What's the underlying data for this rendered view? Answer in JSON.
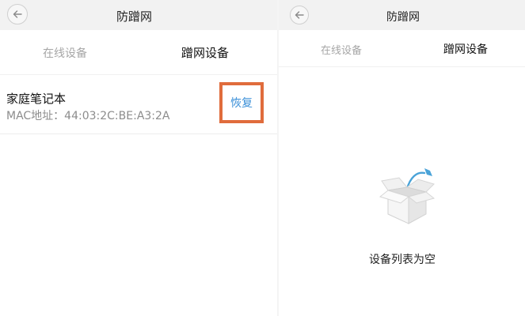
{
  "left_screen": {
    "title": "防蹭网",
    "tabs": [
      {
        "label": "在线设备",
        "active": false
      },
      {
        "label": "蹭网设备",
        "active": true
      }
    ],
    "device": {
      "name": "家庭笔记本",
      "mac": "MAC地址：44:03:2C:BE:A3:2A",
      "action_label": "恢复"
    }
  },
  "right_screen": {
    "title": "防蹭网",
    "tabs": [
      {
        "label": "在线设备",
        "active": false
      },
      {
        "label": "蹭网设备",
        "active": true
      }
    ],
    "empty_message": "设备列表为空"
  },
  "colors": {
    "header_bg": "#f2f2f2",
    "highlight_border": "#e06c3c",
    "action_blue": "#3a8fd8",
    "kite_blue": "#4aa3d8"
  },
  "icons": {
    "back": "arrow-left-icon",
    "empty_state": "open-box-kite-icon"
  }
}
